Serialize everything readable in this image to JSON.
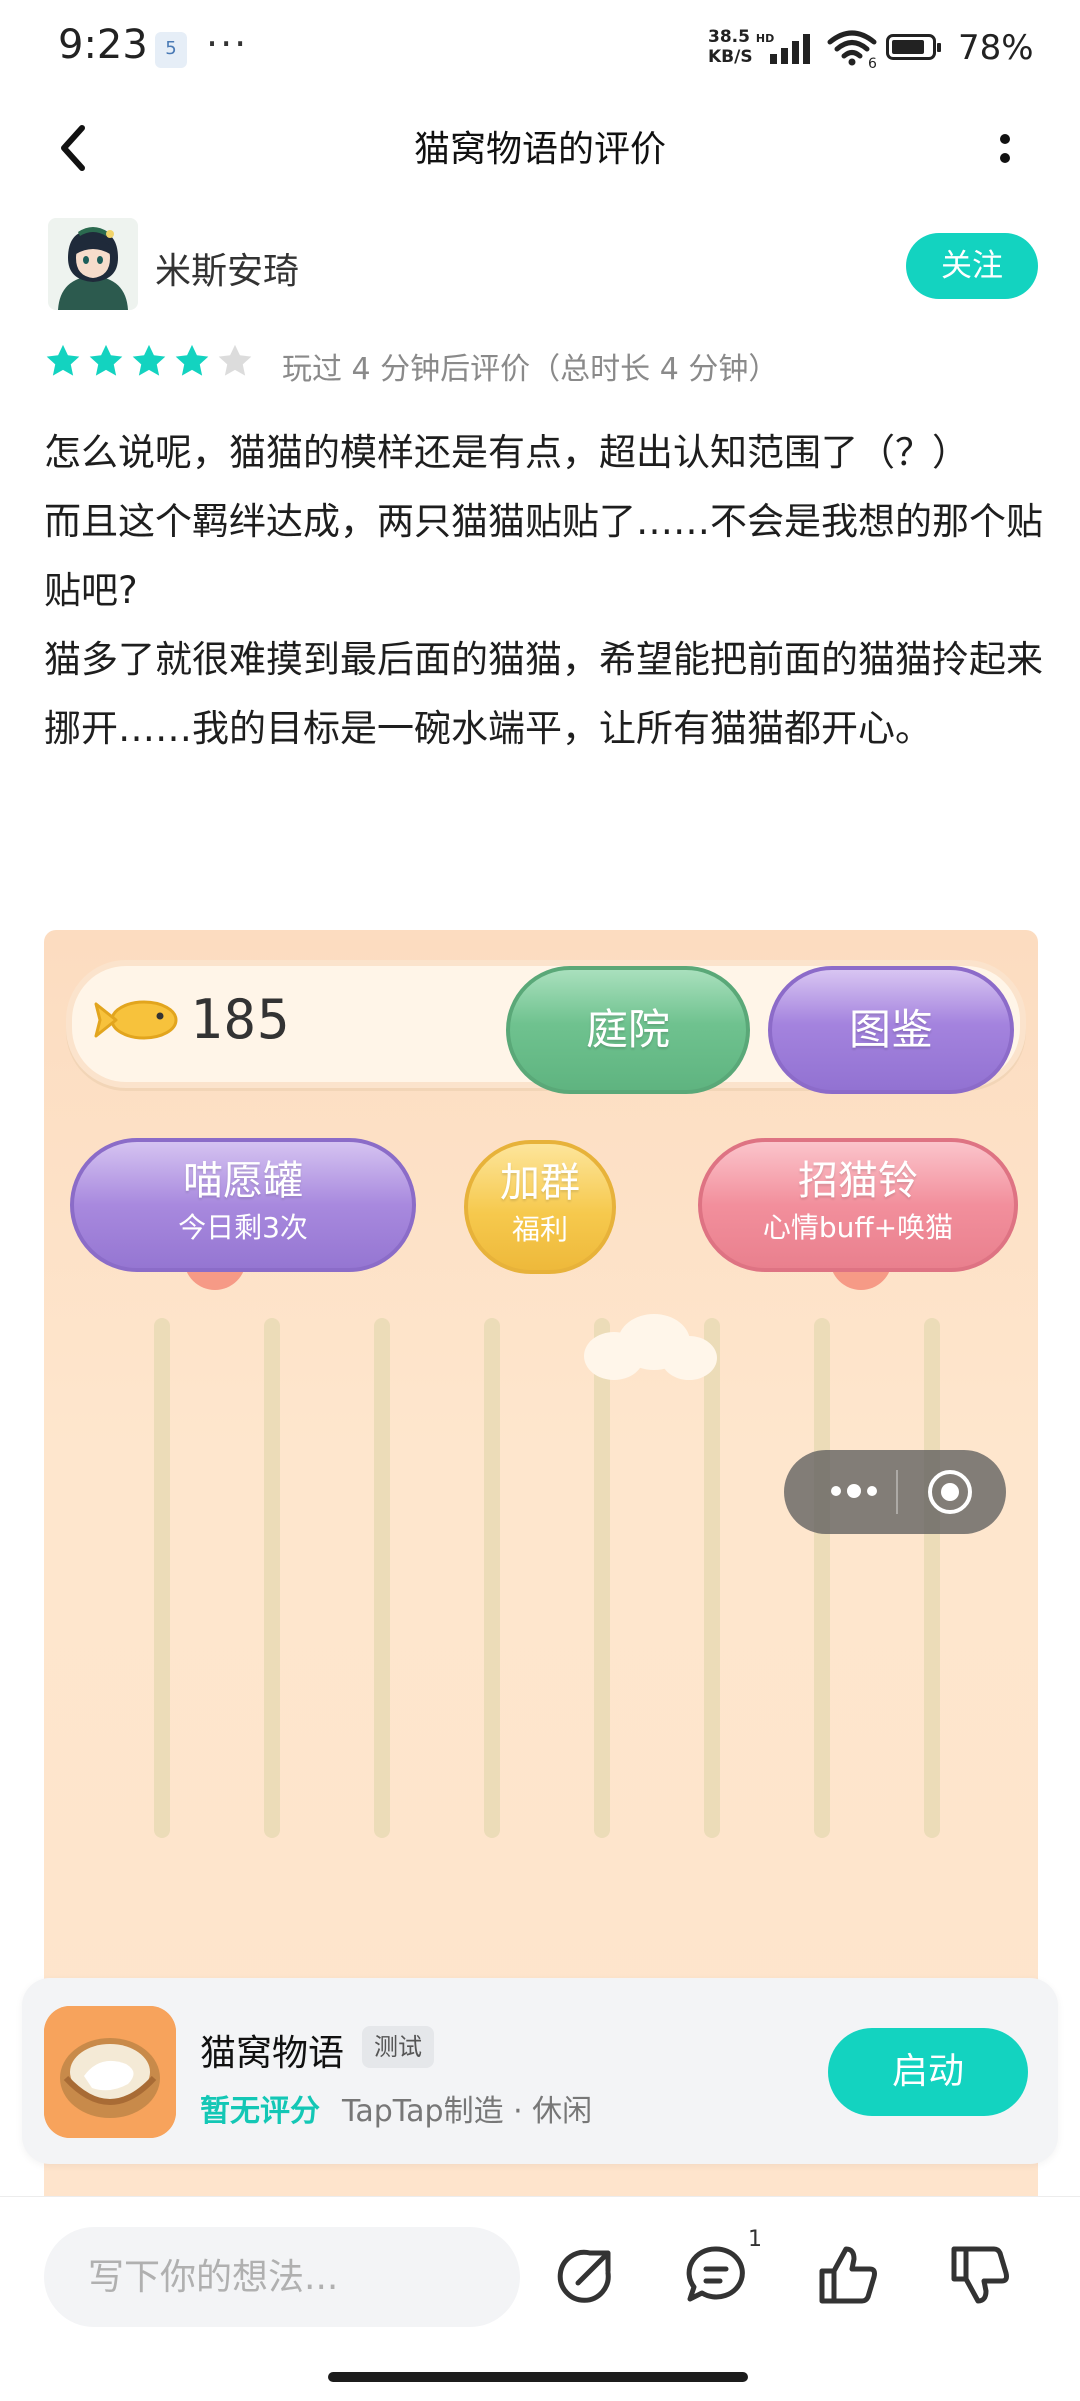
{
  "status": {
    "time": "9:23",
    "badge": "5",
    "dots": "···",
    "net_speed_value": "38.5",
    "net_speed_unit": "KB/S",
    "hd": "HD",
    "signal_label": "6",
    "battery": "78%"
  },
  "nav": {
    "title": "猫窝物语的评价"
  },
  "author": {
    "name": "米斯安琦",
    "follow_label": "关注"
  },
  "rating": {
    "stars": 4,
    "max": 5,
    "note": "玩过 4 分钟后评价（总时长 4 分钟）"
  },
  "review": {
    "paragraphs": [
      "怎么说呢，猫猫的模样还是有点，超出认知范围了（？）",
      "而且这个羁绊达成，两只猫猫贴贴了……不会是我想的那个贴贴吧?",
      "猫多了就很难摸到最后面的猫猫，希望能把前面的猫猫拎起来挪开……我的目标是一碗水端平，让所有猫猫都开心。"
    ]
  },
  "game": {
    "fish_count": "185",
    "btn_courtyard": "庭院",
    "btn_atlas": "图鉴",
    "btn_wish_title": "喵愿罐",
    "btn_wish_sub": "今日剩3次",
    "btn_group_title": "加群",
    "btn_group_sub": "福利",
    "btn_bell_title": "招猫铃",
    "btn_bell_sub": "心情buff+唤猫"
  },
  "app_card": {
    "name": "猫窝物语",
    "tag": "测试",
    "score": "暂无评分",
    "meta": "TapTap制造 · 休闲",
    "launch_label": "启动"
  },
  "bottom": {
    "input_placeholder": "写下你的想法...",
    "reply_count": "1"
  },
  "colors": {
    "accent": "#13d3c0",
    "star": "#13d3c0",
    "star_empty": "#d9d9d9"
  }
}
